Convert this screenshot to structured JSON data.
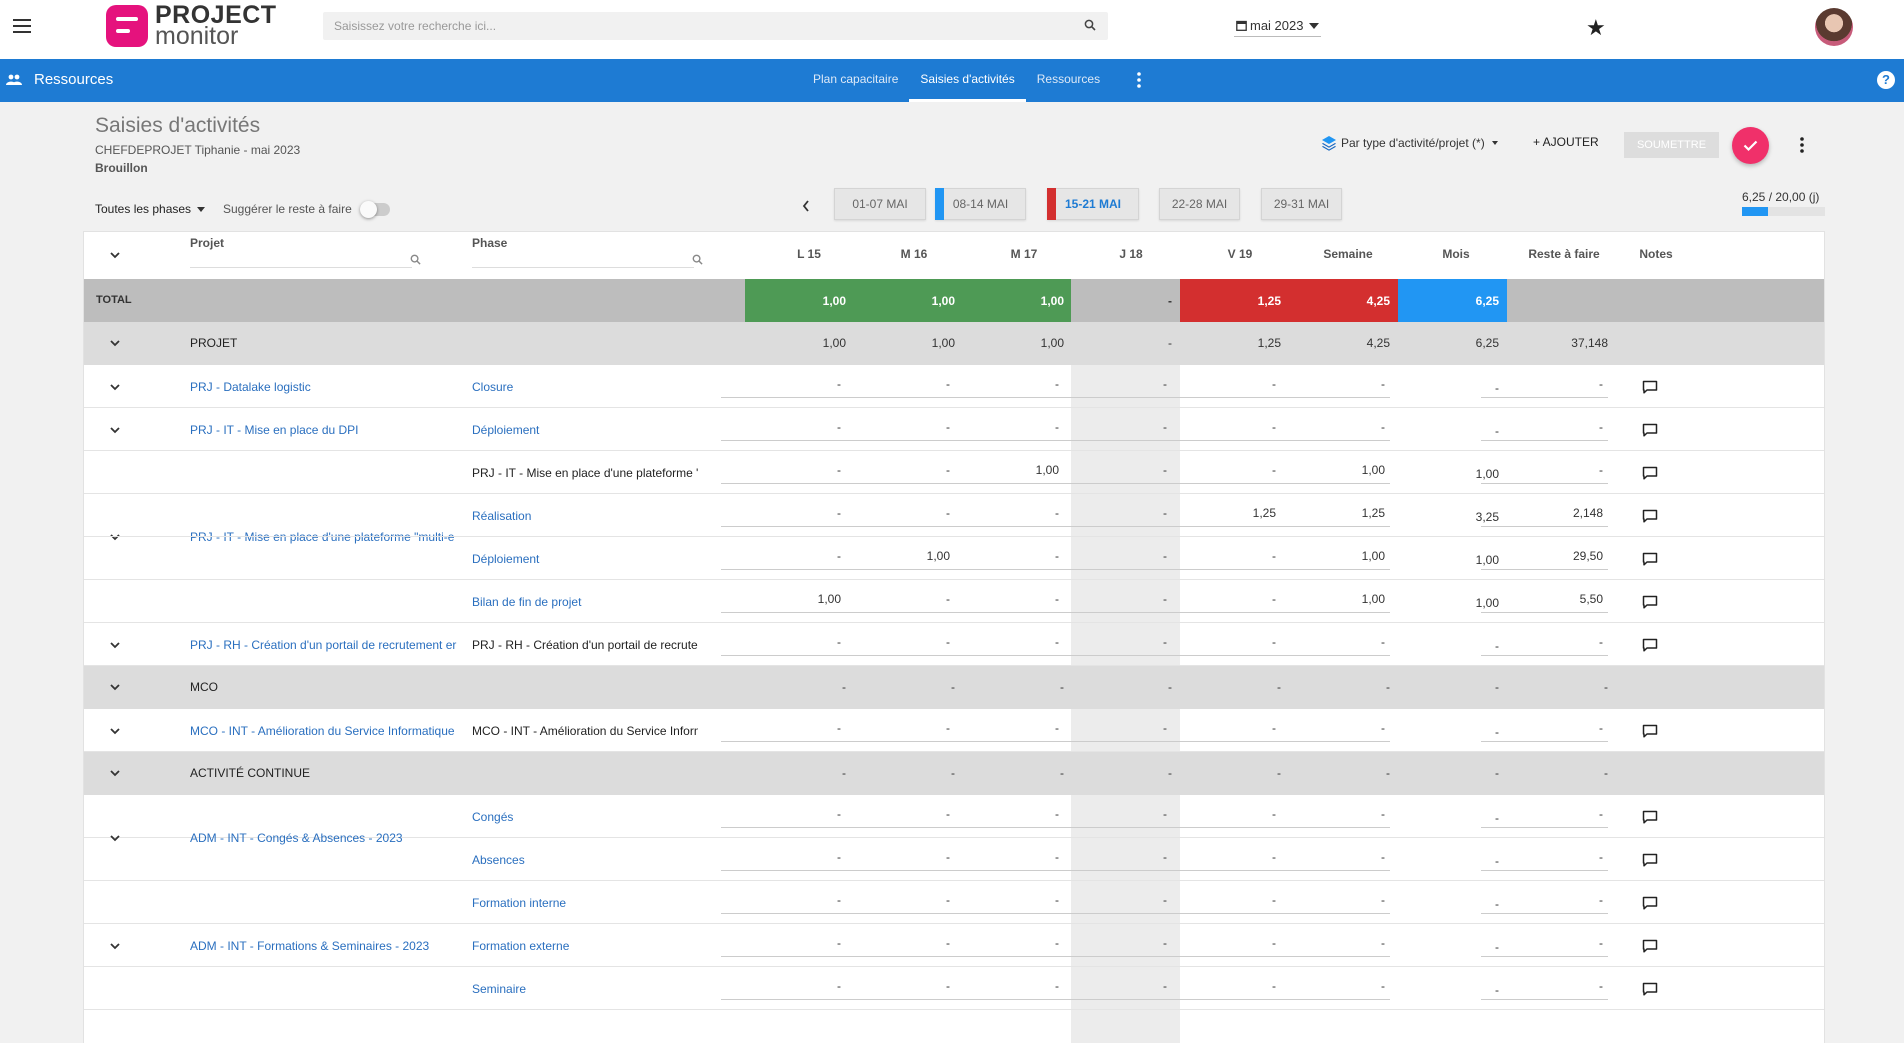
{
  "app": {
    "logo_line1": "PROJECT",
    "logo_line2": "monitor",
    "search_placeholder": "Saisissez votre recherche ici...",
    "month": "mai 2023"
  },
  "nav": {
    "section": "Ressources",
    "tabs": [
      "Plan capacitaire",
      "Saisies d'activités",
      "Ressources"
    ],
    "active_tab": 1,
    "help": "?"
  },
  "page": {
    "title": "Saisies d'activités",
    "subtitle": "CHEFDEPROJET Tiphanie - mai 2023",
    "status": "Brouillon",
    "type_select": "Par type d'activité/projet (*)",
    "add_label": "+ AJOUTER",
    "submit_label": "SOUMETTRE",
    "phases_filter": "Toutes les phases",
    "suggest_label": "Suggérer le reste à faire",
    "suggest_on": false,
    "capacity": "6,25 / 20,00 (j)",
    "capacity_ratio": 0.3125
  },
  "weeks": [
    {
      "label": "01-07 MAI",
      "state": "normal"
    },
    {
      "label": "08-14 MAI",
      "state": "blue"
    },
    {
      "label": "15-21 MAI",
      "state": "active"
    },
    {
      "label": "22-28 MAI",
      "state": "normal"
    },
    {
      "label": "29-31 MAI",
      "state": "normal"
    }
  ],
  "colors": {
    "green": "#4e9a55",
    "red": "#d32f2f",
    "blue": "#2196f3",
    "brand": "#1e7bd3",
    "accent": "#f0306a"
  },
  "columns": {
    "projet": "Projet",
    "phase": "Phase",
    "days": [
      "L 15",
      "M 16",
      "M 17",
      "J 18",
      "V 19"
    ],
    "semaine": "Semaine",
    "mois": "Mois",
    "reste": "Reste à faire",
    "notes": "Notes"
  },
  "total": {
    "label": "TOTAL",
    "values": [
      "1,00",
      "1,00",
      "1,00",
      "-",
      "1,25",
      "4,25",
      "6,25"
    ]
  },
  "groups": [
    {
      "label": "PROJET",
      "values": [
        "1,00",
        "1,00",
        "1,00",
        "-",
        "1,25",
        "4,25",
        "6,25",
        "37,148"
      ]
    },
    {
      "label": "MCO",
      "values": [
        "-",
        "-",
        "-",
        "-",
        "-",
        "-",
        "-",
        "-"
      ]
    },
    {
      "label": "ACTIVITÉ CONTINUE",
      "values": [
        "-",
        "-",
        "-",
        "-",
        "-",
        "-",
        "-",
        "-"
      ]
    }
  ],
  "rows": [
    {
      "project": "PRJ - Datalake logistic",
      "phase": "Closure",
      "phase_link": true,
      "values": [
        "-",
        "-",
        "-",
        "-",
        "-",
        "-",
        "-",
        "-"
      ]
    },
    {
      "project": "PRJ - IT - Mise en place du DPI",
      "phase": "Déploiement",
      "phase_link": true,
      "values": [
        "-",
        "-",
        "-",
        "-",
        "-",
        "-",
        "-",
        "-"
      ]
    },
    {
      "project": "PRJ - IT - Mise en place d'une plateforme \"multi-e",
      "phase": "PRJ - IT - Mise en place d'une plateforme \"multi-e",
      "phase_link": false,
      "values": [
        "-",
        "-",
        "1,00",
        "-",
        "-",
        "1,00",
        "1,00",
        "-"
      ]
    },
    {
      "project": "",
      "phase": "Réalisation",
      "phase_link": true,
      "values": [
        "-",
        "-",
        "-",
        "-",
        "1,25",
        "1,25",
        "3,25",
        "2,148"
      ]
    },
    {
      "project": "",
      "phase": "Déploiement",
      "phase_link": true,
      "values": [
        "-",
        "1,00",
        "-",
        "-",
        "-",
        "1,00",
        "1,00",
        "29,50"
      ]
    },
    {
      "project": "",
      "phase": "Bilan de fin de projet",
      "phase_link": true,
      "values": [
        "1,00",
        "-",
        "-",
        "-",
        "-",
        "1,00",
        "1,00",
        "5,50"
      ]
    },
    {
      "project": "PRJ - RH - Création d'un portail de recrutement er",
      "phase": "PRJ - RH - Création d'un portail de recrutement er",
      "phase_link": false,
      "values": [
        "-",
        "-",
        "-",
        "-",
        "-",
        "-",
        "-",
        "-"
      ]
    },
    {
      "project": "MCO - INT - Amélioration du Service Informatique",
      "phase": "MCO - INT - Amélioration du Service Informatique",
      "phase_link": false,
      "values": [
        "-",
        "-",
        "-",
        "-",
        "-",
        "-",
        "-",
        "-"
      ]
    },
    {
      "project": "ADM - INT - Congés & Absences - 2023",
      "phase": "Congés",
      "phase_link": true,
      "values": [
        "-",
        "-",
        "-",
        "-",
        "-",
        "-",
        "-",
        "-"
      ]
    },
    {
      "project": "",
      "phase": "Absences",
      "phase_link": true,
      "values": [
        "-",
        "-",
        "-",
        "-",
        "-",
        "-",
        "-",
        "-"
      ]
    },
    {
      "project": "ADM - INT - Formations & Seminaires - 2023",
      "phase": "Formation interne",
      "phase_link": true,
      "values": [
        "-",
        "-",
        "-",
        "-",
        "-",
        "-",
        "-",
        "-"
      ]
    },
    {
      "project": "",
      "phase": "Formation externe",
      "phase_link": true,
      "values": [
        "-",
        "-",
        "-",
        "-",
        "-",
        "-",
        "-",
        "-"
      ]
    },
    {
      "project": "",
      "phase": "Seminaire",
      "phase_link": true,
      "values": [
        "-",
        "-",
        "-",
        "-",
        "-",
        "-",
        "-",
        "-"
      ]
    }
  ]
}
